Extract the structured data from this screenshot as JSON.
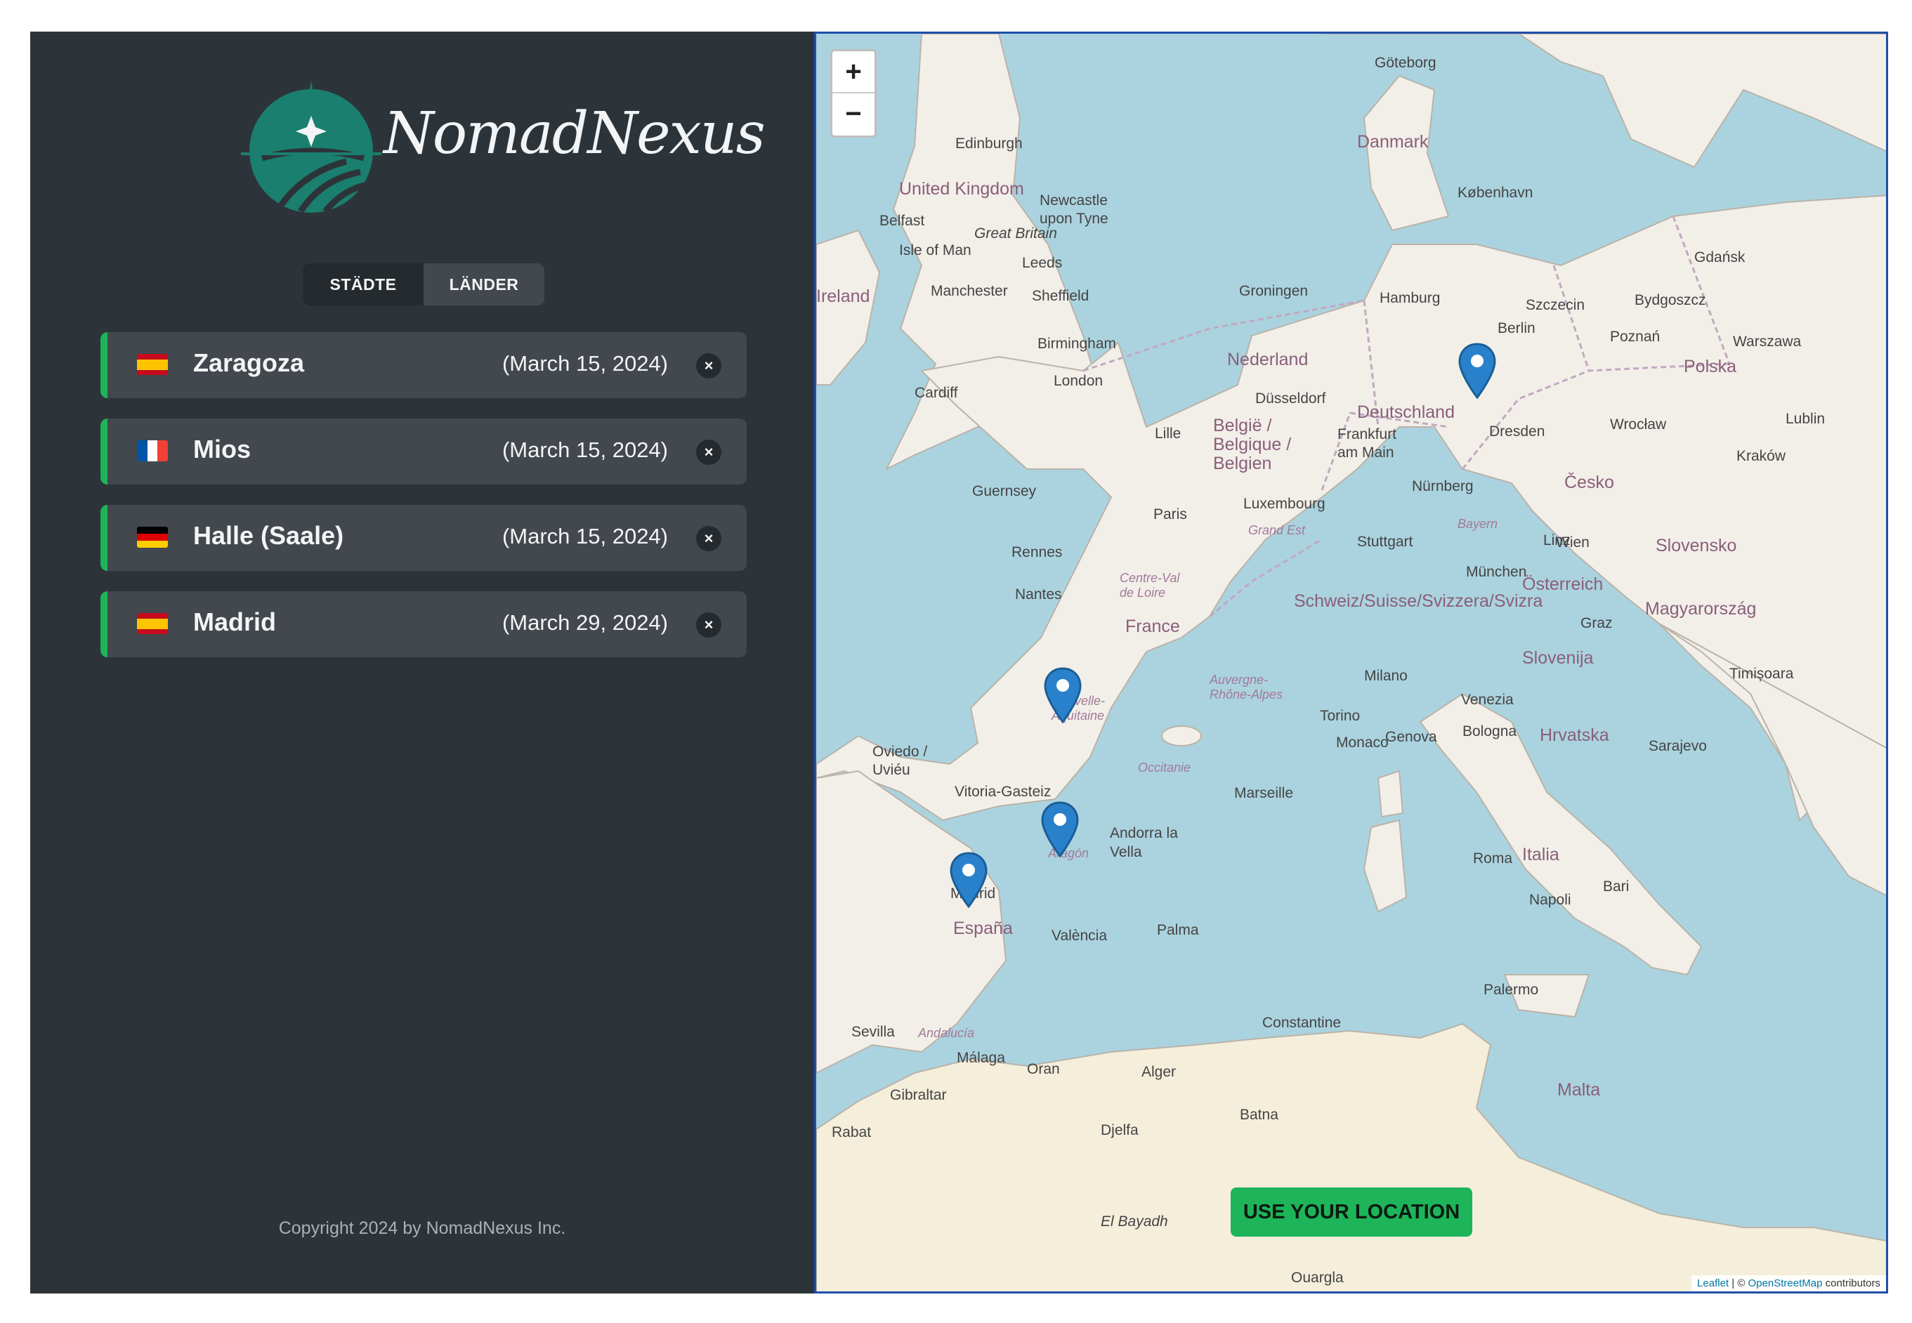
{
  "app": {
    "name": "NomadNexus",
    "colors": {
      "sidebar_bg": "#2d3439",
      "item_bg": "#42484d",
      "accent": "#1eb45a",
      "logo": "#1a7f6e",
      "map_border": "#1f4fa8"
    }
  },
  "tabs": [
    {
      "label": "STÄDTE",
      "active": true
    },
    {
      "label": "LÄNDER",
      "active": false
    }
  ],
  "cities": [
    {
      "name": "Zaragoza",
      "date": "(March 15, 2024)",
      "flag": "spain-flag-icon"
    },
    {
      "name": "Mios",
      "date": "(March 15, 2024)",
      "flag": "france-flag-icon"
    },
    {
      "name": "Halle (Saale)",
      "date": "(March 15, 2024)",
      "flag": "germany-flag-icon"
    },
    {
      "name": "Madrid",
      "date": "(March 29, 2024)",
      "flag": "spain-flag-icon"
    }
  ],
  "delete_symbol": "×",
  "footer": {
    "copyright": "Copyright 2024 by NomadNexus Inc."
  },
  "map": {
    "zoom_in": "+",
    "zoom_out": "−",
    "locate_button": "USE YOUR LOCATION",
    "attribution": {
      "leaflet": "Leaflet",
      "separator": " | © ",
      "osm": "OpenStreetMap",
      "suffix": " contributors"
    },
    "labels": {
      "united_kingdom": "United Kingdom",
      "great_britain": "Great Britain",
      "ireland": "Ireland",
      "danmark": "Danmark",
      "nederland": "Nederland",
      "belgie": "België / Belgique / Belgien",
      "deutschland": "Deutschland",
      "polska": "Polska",
      "france": "France",
      "espana": "España",
      "italia": "Italia",
      "osterreich": "Österreich",
      "cesko": "Česko",
      "schweiz": "Schweiz/Suisse/Svizzera/Svizra",
      "slovenija": "Slovenija",
      "hrvatska": "Hrvatska",
      "magyarorszag": "Magyarország",
      "malta": "Malta",
      "edinburgh": "Edinburgh",
      "london": "London",
      "birmingham": "Birmingham",
      "manchester": "Manchester",
      "paris": "Paris",
      "rennes": "Rennes",
      "nantes": "Nantes",
      "marseille": "Marseille",
      "madrid": "Madrid",
      "valencia": "València",
      "palma": "Palma",
      "sevilla": "Sevilla",
      "malaga": "Málaga",
      "barcelona_andorra": "Andorra la Vella",
      "milano": "Milano",
      "torino": "Torino",
      "genova": "Genova",
      "venezia": "Venezia",
      "bologna": "Bologna",
      "roma": "Roma",
      "napoli": "Napoli",
      "palermo": "Palermo",
      "berlin": "Berlin",
      "hamburg": "Hamburg",
      "dresden": "Dresden",
      "nurnberg": "Nürnberg",
      "munchen": "München",
      "frankfurt": "Frankfurt am Main",
      "stuttgart": "Stuttgart",
      "dusseldorf": "Düsseldorf",
      "kobenhavn": "København",
      "goteborg": "Göteborg",
      "wien": "Wien",
      "graz": "Graz",
      "wroclaw": "Wrocław",
      "krakow": "Kraków",
      "warszawa": "Warszawa",
      "gdansk": "Gdańsk",
      "luxembourg": "Luxembourg",
      "lille": "Lille",
      "oviedo": "Oviedo / Uviéu",
      "vitoria": "Vitoria-Gasteiz",
      "aragon": "Aragón",
      "nouvelle_aquitaine": "Nouvelle-Aquitaine",
      "occitanie": "Occitanie",
      "auvergne": "Auvergne-Rhône-Alpes",
      "centre": "Centre-Val de Loire",
      "grand_est": "Grand Est",
      "bayern": "Bayern",
      "andalucia": "Andalucía",
      "alger": "Alger",
      "oran": "Oran",
      "constantine": "Constantine",
      "gibraltar": "Gibraltar",
      "rabat": "Rabat",
      "guernsey": "Guernsey",
      "isle_of_man": "Isle of Man",
      "belfast": "Belfast",
      "leeds": "Leeds",
      "sheffield": "Sheffield",
      "cardiff": "Cardiff",
      "newcastle": "Newcastle upon Tyne",
      "groningen": "Groningen",
      "szczecin": "Szczecin",
      "poznan": "Poznań",
      "bydgoszcz": "Bydgoszcz",
      "lublin": "Lublin",
      "linz": "Linz",
      "slovensko": "Slovensko",
      "sarajevo": "Sarajevo",
      "monaco": "Monaco",
      "bari": "Bari",
      "timisoara": "Timișoara",
      "el_bayadh": "El Bayadh",
      "batna": "Batna",
      "djelfa": "Djelfa",
      "ouargla": "Ouargla"
    }
  }
}
